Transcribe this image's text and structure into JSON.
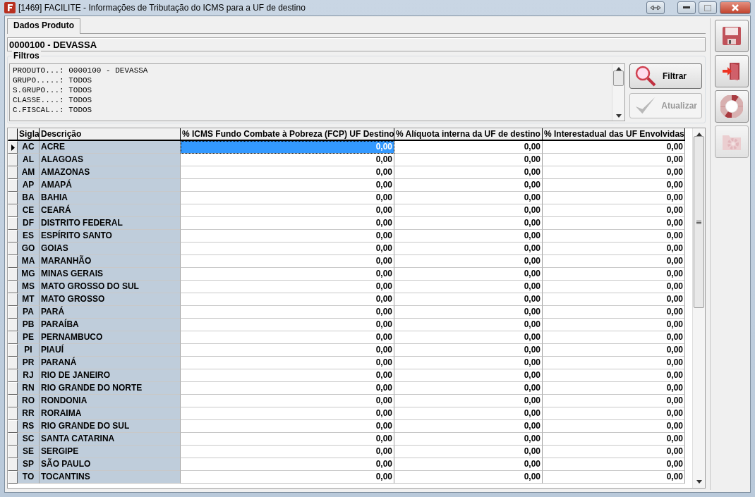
{
  "window": {
    "title": "[1469] FACILITE - Informações de Tributação do ICMS para a UF de destino"
  },
  "tabs": [
    {
      "label": "Dados Produto",
      "selected": true
    }
  ],
  "product": "0000100 - DEVASSA",
  "filters": {
    "title": "Filtros",
    "lines": [
      "PRODUTO...: 0000100 - DEVASSA",
      "GRUPO.....: TODOS",
      "S.GRUPO...: TODOS",
      "CLASSE....: TODOS",
      "C.FISCAL..: TODOS"
    ],
    "buttons": [
      {
        "label": "Filtrar",
        "kind": "search",
        "disabled": false
      },
      {
        "label": "Atualizar",
        "kind": "check",
        "disabled": true
      }
    ]
  },
  "table": {
    "columns": [
      "Sigla",
      "Descrição",
      "% ICMS Fundo Combate à Pobreza (FCP) UF Destino",
      "% Alíquota interna da UF de destino",
      "% Interestadual das UF Envolvidas"
    ],
    "rows": [
      {
        "cells": [
          "AC",
          "ACRE",
          "0,00",
          "0,00",
          "0,00"
        ],
        "selected": true
      },
      {
        "cells": [
          "AL",
          "ALAGOAS",
          "0,00",
          "0,00",
          "0,00"
        ],
        "selected": false
      },
      {
        "cells": [
          "AM",
          "AMAZONAS",
          "0,00",
          "0,00",
          "0,00"
        ],
        "selected": false
      },
      {
        "cells": [
          "AP",
          "AMAPÁ",
          "0,00",
          "0,00",
          "0,00"
        ],
        "selected": false
      },
      {
        "cells": [
          "BA",
          "BAHIA",
          "0,00",
          "0,00",
          "0,00"
        ],
        "selected": false
      },
      {
        "cells": [
          "CE",
          "CEARÁ",
          "0,00",
          "0,00",
          "0,00"
        ],
        "selected": false
      },
      {
        "cells": [
          "DF",
          "DISTRITO FEDERAL",
          "0,00",
          "0,00",
          "0,00"
        ],
        "selected": false
      },
      {
        "cells": [
          "ES",
          "ESPÍRITO SANTO",
          "0,00",
          "0,00",
          "0,00"
        ],
        "selected": false
      },
      {
        "cells": [
          "GO",
          "GOIAS",
          "0,00",
          "0,00",
          "0,00"
        ],
        "selected": false
      },
      {
        "cells": [
          "MA",
          "MARANHÃO",
          "0,00",
          "0,00",
          "0,00"
        ],
        "selected": false
      },
      {
        "cells": [
          "MG",
          "MINAS GERAIS",
          "0,00",
          "0,00",
          "0,00"
        ],
        "selected": false
      },
      {
        "cells": [
          "MS",
          "MATO GROSSO DO SUL",
          "0,00",
          "0,00",
          "0,00"
        ],
        "selected": false
      },
      {
        "cells": [
          "MT",
          "MATO GROSSO",
          "0,00",
          "0,00",
          "0,00"
        ],
        "selected": false
      },
      {
        "cells": [
          "PA",
          "PARÁ",
          "0,00",
          "0,00",
          "0,00"
        ],
        "selected": false
      },
      {
        "cells": [
          "PB",
          "PARAÍBA",
          "0,00",
          "0,00",
          "0,00"
        ],
        "selected": false
      },
      {
        "cells": [
          "PE",
          "PERNAMBUCO",
          "0,00",
          "0,00",
          "0,00"
        ],
        "selected": false
      },
      {
        "cells": [
          "PI",
          "PIAUÍ",
          "0,00",
          "0,00",
          "0,00"
        ],
        "selected": false
      },
      {
        "cells": [
          "PR",
          "PARANÁ",
          "0,00",
          "0,00",
          "0,00"
        ],
        "selected": false
      },
      {
        "cells": [
          "RJ",
          "RIO DE JANEIRO",
          "0,00",
          "0,00",
          "0,00"
        ],
        "selected": false
      },
      {
        "cells": [
          "RN",
          "RIO GRANDE DO NORTE",
          "0,00",
          "0,00",
          "0,00"
        ],
        "selected": false
      },
      {
        "cells": [
          "RO",
          "RONDONIA",
          "0,00",
          "0,00",
          "0,00"
        ],
        "selected": false
      },
      {
        "cells": [
          "RR",
          "RORAIMA",
          "0,00",
          "0,00",
          "0,00"
        ],
        "selected": false
      },
      {
        "cells": [
          "RS",
          "RIO GRANDE DO SUL",
          "0,00",
          "0,00",
          "0,00"
        ],
        "selected": false
      },
      {
        "cells": [
          "SC",
          "SANTA CATARINA",
          "0,00",
          "0,00",
          "0,00"
        ],
        "selected": false
      },
      {
        "cells": [
          "SE",
          "SERGIPE",
          "0,00",
          "0,00",
          "0,00"
        ],
        "selected": false
      },
      {
        "cells": [
          "SP",
          "SÃO PAULO",
          "0,00",
          "0,00",
          "0,00"
        ],
        "selected": false
      },
      {
        "cells": [
          "TO",
          "TOCANTINS",
          "0,00",
          "0,00",
          "0,00"
        ],
        "selected": false
      }
    ]
  },
  "toolbar": [
    {
      "kind": "save",
      "disabled": false
    },
    {
      "kind": "exit",
      "disabled": false
    },
    {
      "kind": "help",
      "disabled": false
    },
    {
      "kind": "settings",
      "disabled": true
    }
  ]
}
